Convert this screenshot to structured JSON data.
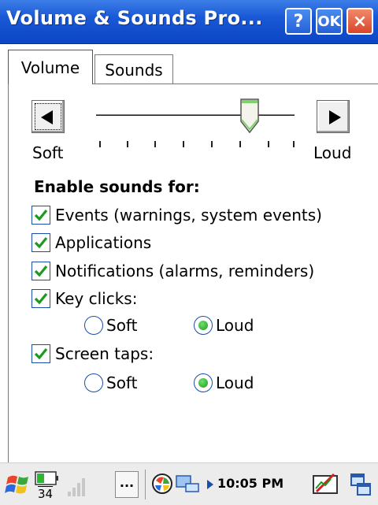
{
  "window": {
    "title": "Volume & Sounds Pro...",
    "help_label": "?",
    "ok_label": "OK",
    "close_label": "×"
  },
  "tabs": [
    {
      "label": "Volume",
      "active": true
    },
    {
      "label": "Sounds",
      "active": false
    }
  ],
  "volume": {
    "soft_label": "Soft",
    "loud_label": "Loud",
    "level_fraction": 0.77,
    "tick_count": 8
  },
  "enable_heading": "Enable sounds for:",
  "checkboxes": {
    "events": {
      "label": "Events (warnings, system events)",
      "checked": true
    },
    "applications": {
      "label": "Applications",
      "checked": true
    },
    "notifications": {
      "label": "Notifications (alarms, reminders)",
      "checked": true
    },
    "key_clicks": {
      "label": "Key clicks:",
      "checked": true
    },
    "screen_taps": {
      "label": "Screen taps:",
      "checked": true
    }
  },
  "key_clicks_options": {
    "soft": "Soft",
    "loud": "Loud",
    "selected": "loud"
  },
  "screen_taps_options": {
    "soft": "Soft",
    "loud": "Loud",
    "selected": "loud"
  },
  "taskbar": {
    "battery_level": "34",
    "overflow_label": "...",
    "clock": "10:05 PM"
  },
  "colors": {
    "titlebar": "#1958d6",
    "close_button": "#d9452a",
    "check_accent": "#1d9a1d",
    "taskbar_bg": "#ececec"
  }
}
